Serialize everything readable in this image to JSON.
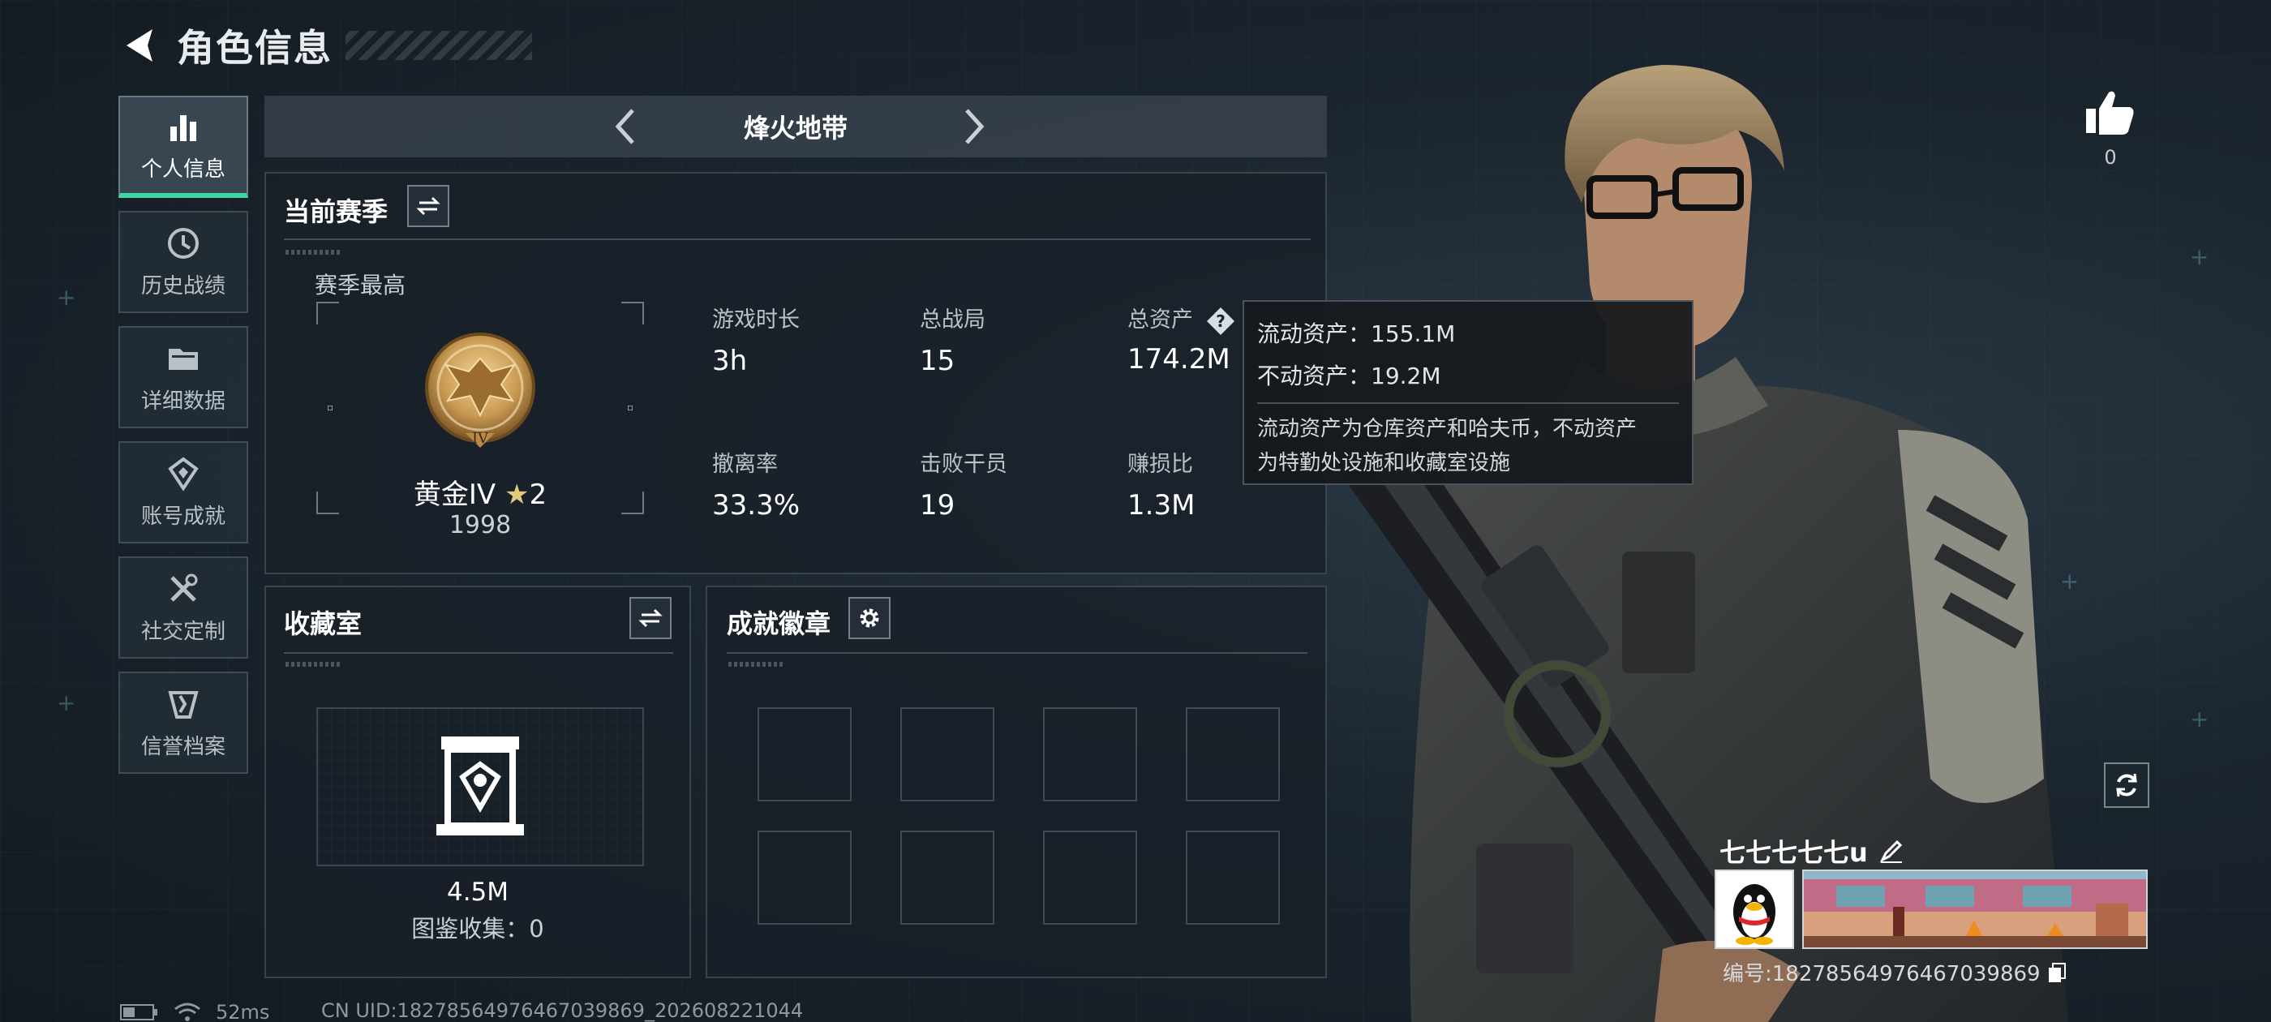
{
  "header": {
    "title": "角色信息"
  },
  "sidebar": {
    "items": [
      {
        "label": "个人信息",
        "icon": "bar-chart-icon",
        "active": true
      },
      {
        "label": "历史战绩",
        "icon": "history-icon",
        "active": false
      },
      {
        "label": "详细数据",
        "icon": "folder-icon",
        "active": false
      },
      {
        "label": "账号成就",
        "icon": "achievement-icon",
        "active": false
      },
      {
        "label": "社交定制",
        "icon": "tools-icon",
        "active": false
      },
      {
        "label": "信誉档案",
        "icon": "credit-icon",
        "active": false
      }
    ]
  },
  "mode": {
    "title": "烽火地带"
  },
  "season": {
    "title": "当前赛季",
    "best_label": "赛季最高",
    "rank_name": "黄金IV",
    "rank_stars": "2",
    "rank_score": "1998",
    "stats": [
      {
        "label": "游戏时长",
        "value": "3h"
      },
      {
        "label": "总战局",
        "value": "15"
      },
      {
        "label": "总资产",
        "value": "174.2M"
      },
      {
        "label": "撤离率",
        "value": "33.3%"
      },
      {
        "label": "击败干员",
        "value": "19"
      },
      {
        "label": "赚损比",
        "value": "1.3M"
      }
    ]
  },
  "tooltip": {
    "liquid": "流动资产：155.1M",
    "fixed": "不动资产：19.2M",
    "desc_line1": "流动资产为仓库资产和哈夫币，不动资产",
    "desc_line2": "为特勤处设施和收藏室设施"
  },
  "collection": {
    "title": "收藏室",
    "value": "4.5M",
    "count": "图鉴收集：0"
  },
  "badges": {
    "title": "成就徽章",
    "slots": 8
  },
  "likes": {
    "count": "0"
  },
  "player": {
    "name": "七七七七七u",
    "id": "编号:1827856497646703986​9"
  },
  "status": {
    "ping": "52ms",
    "uid": "CN UID:1827856497646703986​9_202608221044"
  },
  "colors": {
    "accent": "#3ed6a2",
    "panel": "#18202a"
  }
}
